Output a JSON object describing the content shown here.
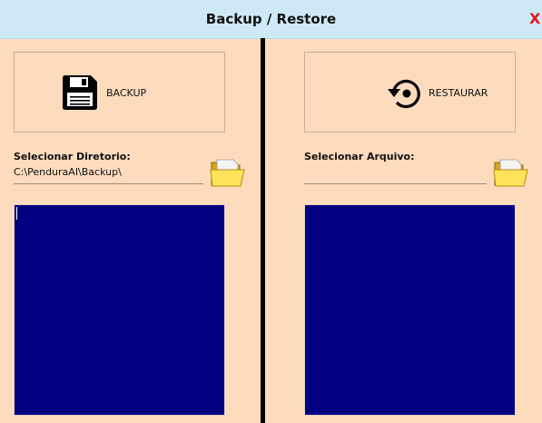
{
  "window": {
    "title": "Backup / Restore",
    "close_label": "X"
  },
  "backup": {
    "button_label": "BACKUP",
    "icon": "floppy-disk-icon",
    "field_label": "Selecionar Diretorio:",
    "path_value": "C:\\PenduraAI\\Backup\\",
    "folder_icon": "folder-icon"
  },
  "restore": {
    "button_label": "RESTAURAR",
    "icon": "restore-icon",
    "field_label": "Selecionar Arquivo:",
    "path_value": "",
    "folder_icon": "folder-icon"
  },
  "colors": {
    "background": "#fddcbd",
    "titlebar": "#cde9f6",
    "close": "#e8141b",
    "listbox": "#000080"
  }
}
